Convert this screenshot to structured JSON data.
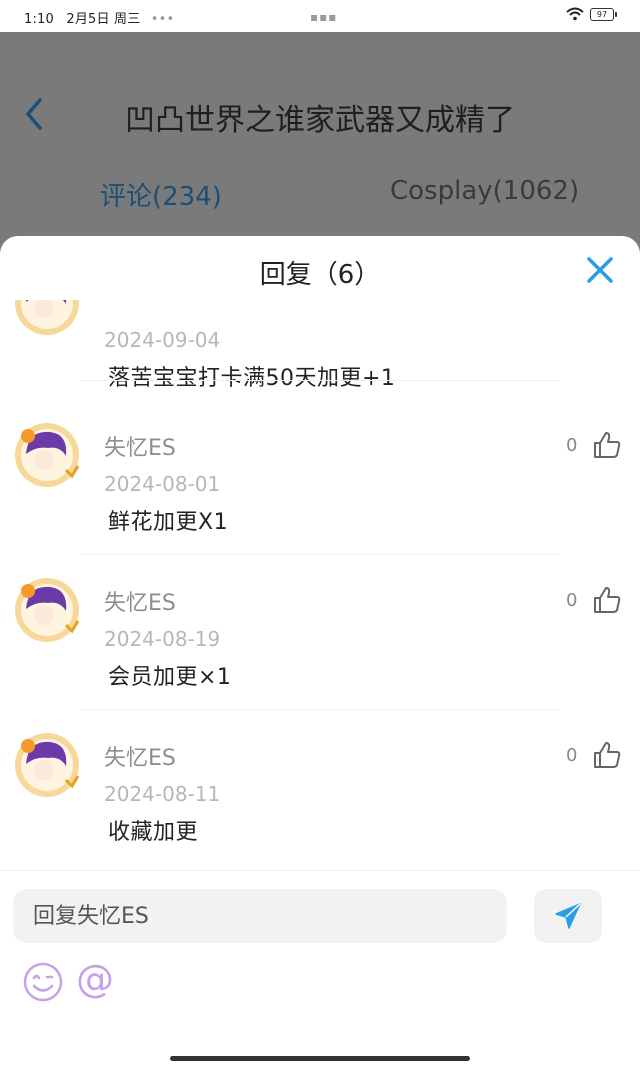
{
  "status_bar": {
    "time": "1:10",
    "date": "2月5日 周三",
    "extra": "•••",
    "battery": "97"
  },
  "header": {
    "title": "凹凸世界之谁家武器又成精了"
  },
  "tabs": [
    {
      "label": "评论(234)",
      "active": true
    },
    {
      "label": "Cosplay(1062)",
      "active": false
    }
  ],
  "sheet": {
    "title": "回复（6）",
    "replies": [
      {
        "username": "",
        "date": "2024-09-04",
        "text": "落苦宝宝打卡满50天加更+1",
        "likes": ""
      },
      {
        "username": "失忆ES",
        "date": "2024-08-01",
        "text": "鲜花加更X1",
        "likes": "0"
      },
      {
        "username": "失忆ES",
        "date": "2024-08-19",
        "text": "会员加更×1",
        "likes": "0"
      },
      {
        "username": "失忆ES",
        "date": "2024-08-11",
        "text": "收藏加更",
        "likes": "0"
      }
    ],
    "input": {
      "placeholder": "回复失忆ES",
      "value": ""
    },
    "at_symbol": "@"
  },
  "colors": {
    "accent": "#2b9de8",
    "overlay": "#777777"
  }
}
